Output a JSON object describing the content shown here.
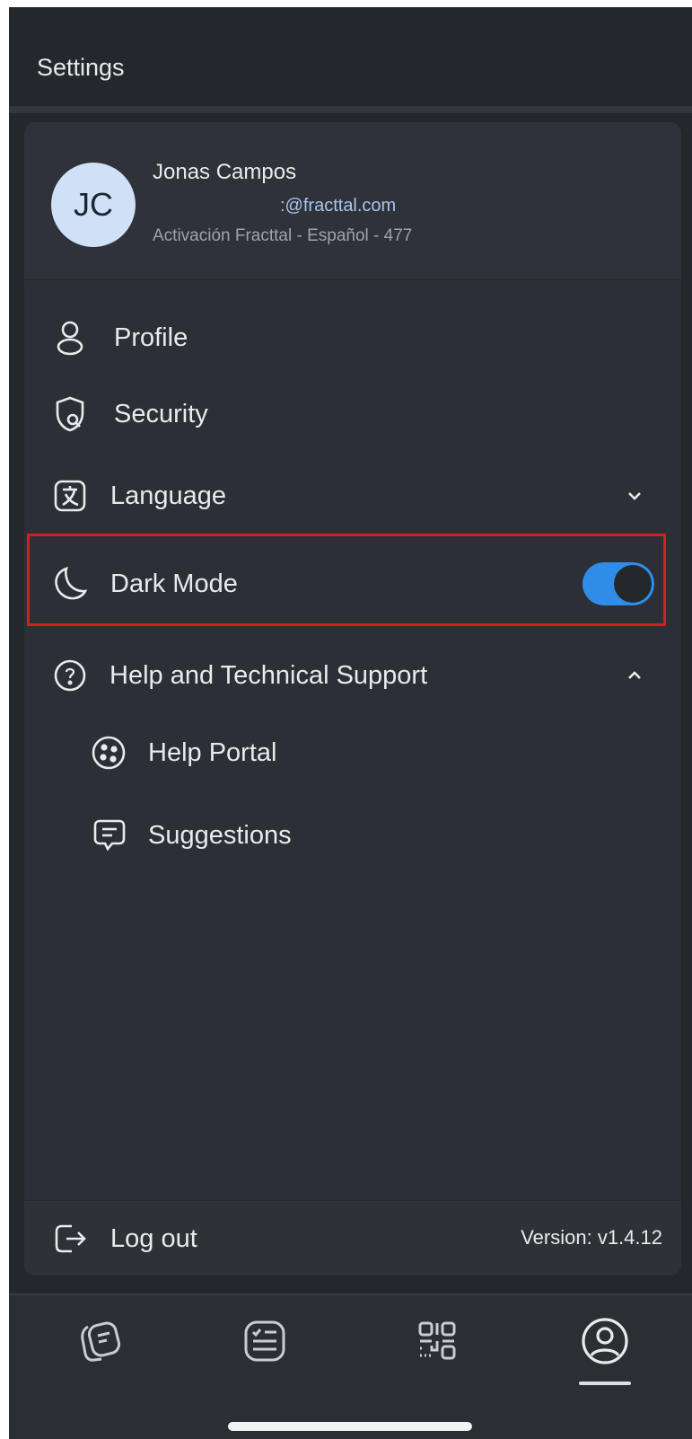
{
  "header": {
    "title": "Settings"
  },
  "user": {
    "initials": "JC",
    "name": "Jonas Campos",
    "email": ":@fracttal.com",
    "company": "Activación Fracttal - Español - 477"
  },
  "menu": {
    "profile": {
      "label": "Profile",
      "icon": "user-icon"
    },
    "security": {
      "label": "Security",
      "icon": "shield-icon"
    },
    "language": {
      "label": "Language",
      "icon": "translate-icon",
      "expanded": false
    },
    "dark_mode": {
      "label": "Dark Mode",
      "icon": "moon-icon",
      "enabled": true
    },
    "help": {
      "label": "Help and Technical Support",
      "icon": "help-circle-icon",
      "expanded": true,
      "children": [
        {
          "label": "Help Portal",
          "icon": "help-portal-icon"
        },
        {
          "label": "Suggestions",
          "icon": "chat-icon"
        }
      ]
    }
  },
  "footer": {
    "logout_label": "Log out",
    "version": "Version: v1.4.12"
  },
  "bottom_nav": {
    "items": [
      {
        "icon": "notes-icon",
        "active": false
      },
      {
        "icon": "checklist-icon",
        "active": false
      },
      {
        "icon": "qr-code-icon",
        "active": false
      },
      {
        "icon": "account-icon",
        "active": true
      }
    ]
  },
  "colors": {
    "accent": "#2f8de8",
    "highlight_border": "#d21e1e",
    "background": "#24272c"
  }
}
